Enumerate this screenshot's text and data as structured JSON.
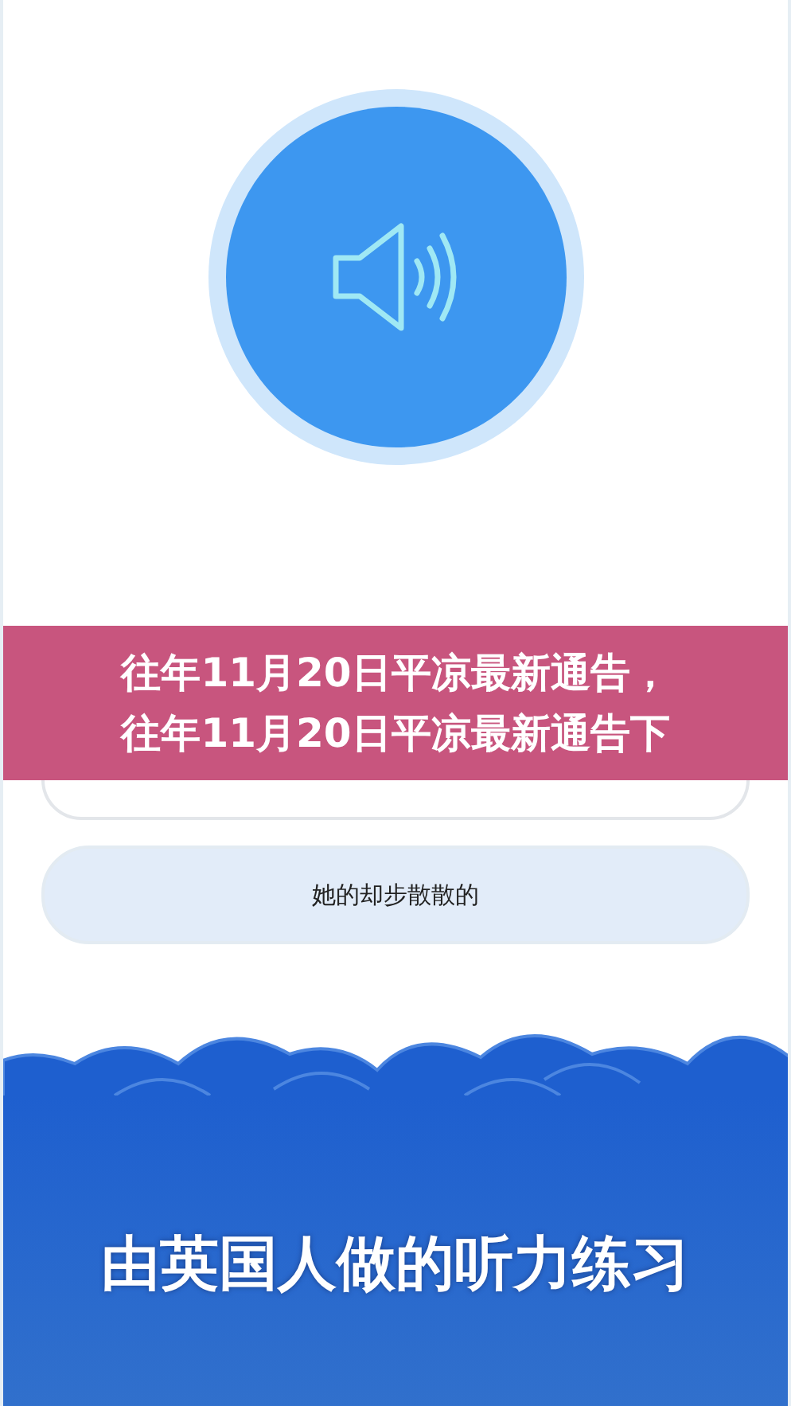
{
  "options": [
    {
      "selected": false
    },
    {
      "text": "她的却步散散的",
      "selected": true
    }
  ],
  "footer_title": "由英国人做的听力练习",
  "banner": {
    "lines": [
      "往年11月20日平凉最新通告，",
      "往年11月20日平凉最新通告下"
    ]
  }
}
